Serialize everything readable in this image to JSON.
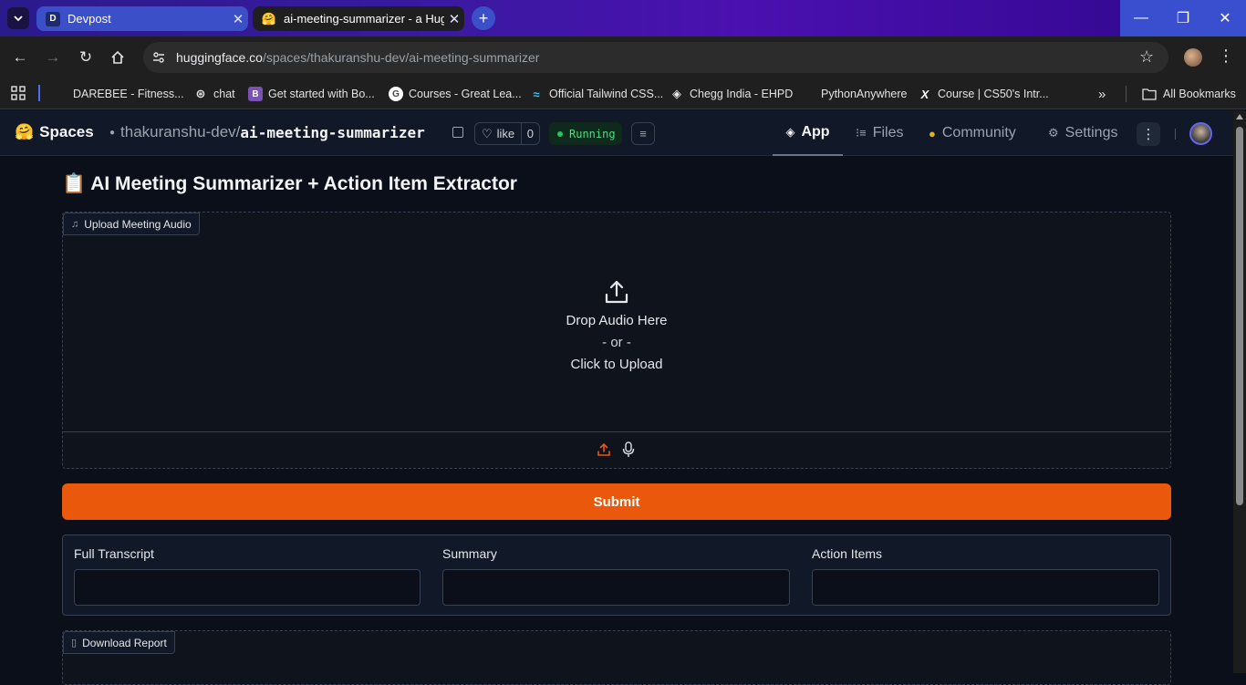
{
  "browser": {
    "tabs": [
      {
        "title": "Devpost",
        "favicon_letter": "D",
        "active": false
      },
      {
        "title": "ai-meeting-summarizer - a Hugg",
        "favicon_letter": "🤗",
        "active": true
      }
    ],
    "url_host": "huggingface.co",
    "url_path": "/spaces/thakuranshu-dev/ai-meeting-summarizer",
    "bookmarks": [
      {
        "label": "DAREBEE - Fitness...",
        "icon": "darebee-icon"
      },
      {
        "label": "chat",
        "icon": "chatgpt-icon"
      },
      {
        "label": "Get started with Bo...",
        "icon": "bootstrap-icon",
        "letter": "B"
      },
      {
        "label": "Courses - Great Lea...",
        "icon": "google-icon",
        "letter": "G"
      },
      {
        "label": "Official Tailwind CSS...",
        "icon": "tailwind-icon"
      },
      {
        "label": "Chegg India - EHPD",
        "icon": "chegg-icon"
      },
      {
        "label": "PythonAnywhere",
        "icon": "pythonanywhere-icon"
      },
      {
        "label": "Course | CS50's Intr...",
        "icon": "edx-icon",
        "letter": "X"
      }
    ],
    "all_bookmarks_label": "All Bookmarks"
  },
  "hf": {
    "spaces_label": "Spaces",
    "owner": "thakuranshu-dev/",
    "repo": "ai-meeting-summarizer",
    "like_label": "like",
    "like_count": "0",
    "status": "Running",
    "tabs": [
      {
        "label": "App",
        "icon": "cube-icon",
        "active": true
      },
      {
        "label": "Files",
        "icon": "files-icon",
        "active": false
      },
      {
        "label": "Community",
        "icon": "community-icon",
        "active": false
      },
      {
        "label": "Settings",
        "icon": "gear-icon",
        "active": false
      }
    ]
  },
  "app": {
    "title_emoji": "📋",
    "title": "AI Meeting Summarizer + Action Item Extractor",
    "upload_label": "Upload Meeting Audio",
    "drop_text": "Drop Audio Here",
    "or_text": "- or -",
    "click_text": "Click to Upload",
    "submit_label": "Submit",
    "outputs": [
      {
        "label": "Full Transcript",
        "value": ""
      },
      {
        "label": "Summary",
        "value": ""
      },
      {
        "label": "Action Items",
        "value": ""
      }
    ],
    "download_label": "Download Report"
  },
  "colors": {
    "accent": "#ea580c",
    "status_green": "#22c55e",
    "bg": "#0b0f19"
  }
}
